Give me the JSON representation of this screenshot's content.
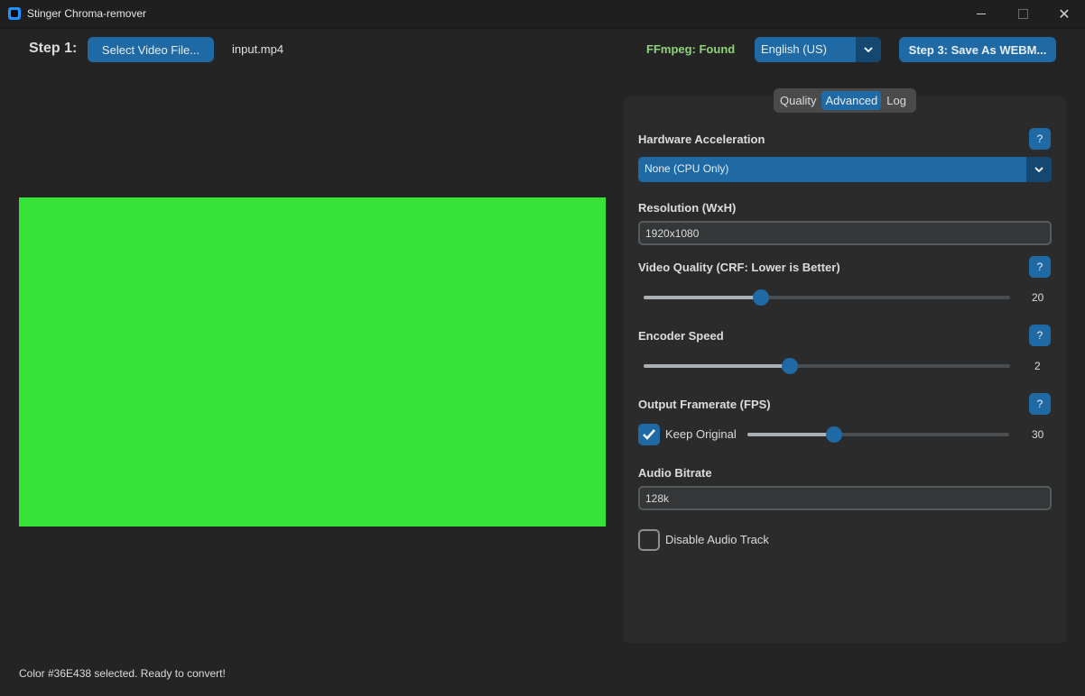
{
  "window": {
    "title": "Stinger Chroma-remover",
    "minimize": "–",
    "maximize": "□",
    "close": "✕"
  },
  "top": {
    "step1_label": "Step 1:",
    "select_button": "Select Video File...",
    "file_name": "input.mp4",
    "ffmpeg_status": "FFmpeg: Found",
    "language": "English (US)",
    "save_button": "Step 3: Save As WEBM..."
  },
  "preview": {
    "color": "#36E438"
  },
  "tabs": [
    {
      "label": "Quality",
      "active": false
    },
    {
      "label": "Advanced",
      "active": true
    },
    {
      "label": "Log",
      "active": false
    }
  ],
  "settings": {
    "hw_accel": {
      "label": "Hardware Acceleration",
      "value": "None (CPU Only)",
      "help": "?"
    },
    "resolution": {
      "label": "Resolution (WxH)",
      "value": "1920x1080"
    },
    "crf": {
      "label": "Video Quality (CRF: Lower is Better)",
      "value": "20",
      "level": 0.32,
      "help": "?"
    },
    "encoder_speed": {
      "label": "Encoder Speed",
      "value": "2",
      "level": 0.4,
      "help": "?"
    },
    "framerate": {
      "label": "Output Framerate (FPS)",
      "keep_original": "Keep Original",
      "keep_checked": true,
      "value": "30",
      "level": 0.33,
      "help": "?"
    },
    "audio_bitrate": {
      "label": "Audio Bitrate",
      "value": "128k"
    },
    "disable_audio": {
      "label": "Disable Audio Track",
      "checked": false
    }
  },
  "status": "Color #36E438 selected. Ready to convert!",
  "colors": {
    "accent": "#1f6aa5",
    "ffmpeg_ok": "#8fd27a",
    "background": "#242424",
    "panel": "#2b2b2b"
  }
}
